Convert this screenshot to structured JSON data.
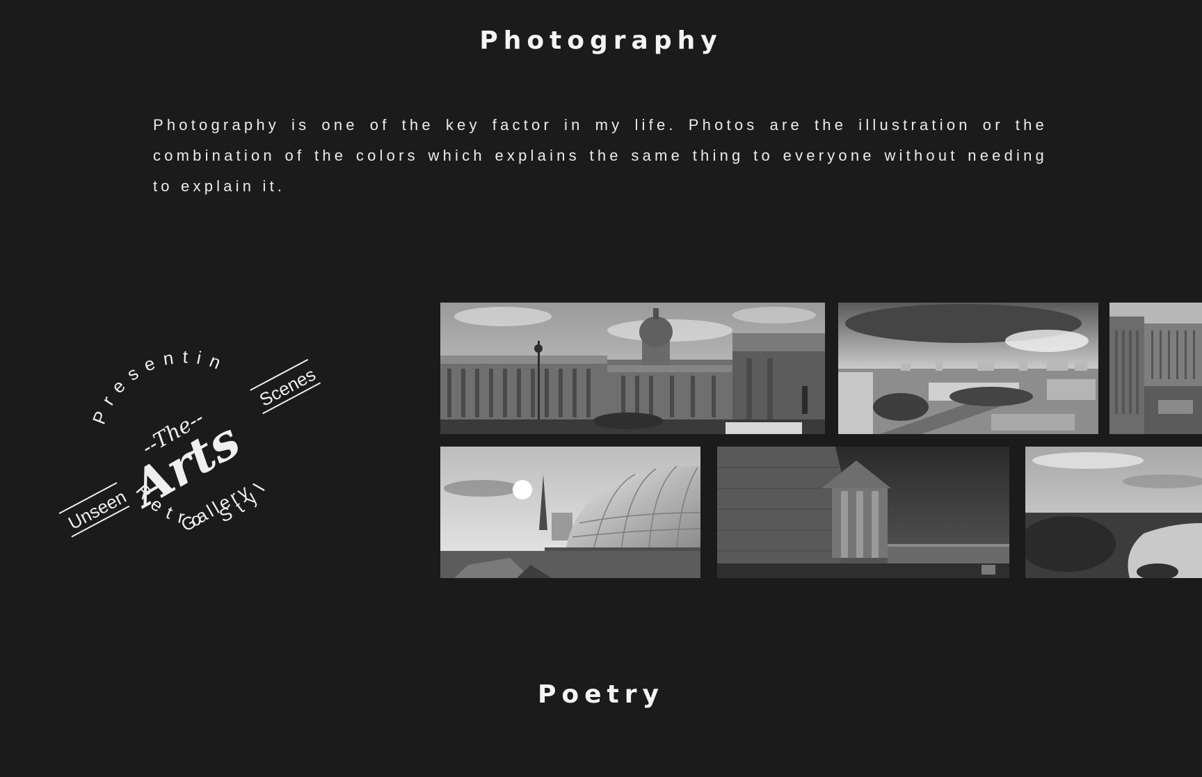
{
  "photography": {
    "title": "Photography",
    "intro": "Photography is one of the key factor in my life. Photos are the illustration or the combination of the colors which explains the same thing to everyone without needing to explain it."
  },
  "emblem": {
    "presenting": "Presenting",
    "the": "--The--",
    "arts": "Arts",
    "gallery": "Gallery",
    "unseen": "Unseen",
    "scenes": "Scenes",
    "retro_style": "Retro Style"
  },
  "gallery": {
    "photos": [
      {
        "name": "colonnade-cathedral-photo"
      },
      {
        "name": "city-aerial-photo"
      },
      {
        "name": "apartment-courtyard-photo"
      },
      {
        "name": "dome-tower-photo"
      },
      {
        "name": "stone-fortress-photo"
      },
      {
        "name": "river-landscape-photo"
      }
    ]
  },
  "poetry": {
    "title": "Poetry"
  }
}
